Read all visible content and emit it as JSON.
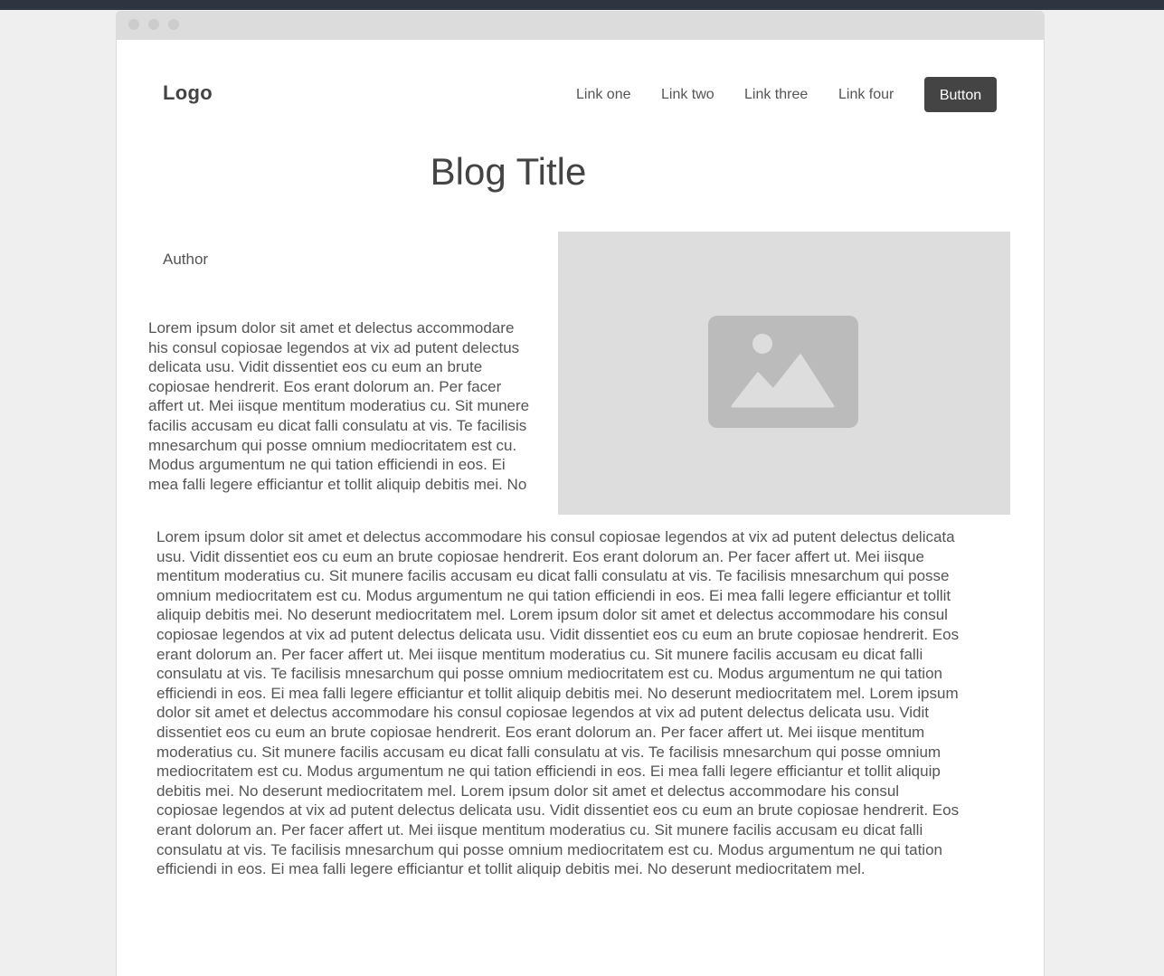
{
  "nav": {
    "logo": "Logo",
    "links": [
      "Link one",
      "Link two",
      "Link three",
      "Link four"
    ],
    "button_label": "Button"
  },
  "post": {
    "title": "Blog Title",
    "author": "Author",
    "intro": "Lorem ipsum dolor sit amet et delectus accommodare his consul copiosae legendos at vix ad putent delectus delicata usu. Vidit dissentiet eos cu eum an brute copiosae hendrerit. Eos erant dolorum an. Per facer affert ut. Mei iisque mentitum moderatius cu. Sit munere facilis accusam eu dicat falli consulatu at vis. Te facilisis mnesarchum qui posse omnium mediocritatem est cu. Modus argumentum ne qui tation efficiendi in eos. Ei mea falli legere efficiantur et tollit aliquip debitis mei. No",
    "image_icon": "image-icon",
    "body": "Lorem ipsum dolor sit amet et delectus accommodare his consul copiosae legendos at vix ad putent delectus delicata usu. Vidit dissentiet eos cu eum an brute copiosae hendrerit. Eos erant dolorum an. Per facer affert ut. Mei iisque mentitum moderatius cu. Sit munere facilis accusam eu dicat falli consulatu at vis. Te facilisis mnesarchum qui posse omnium mediocritatem est cu. Modus argumentum ne qui tation efficiendi in eos. Ei mea falli legere efficiantur et tollit aliquip debitis mei. No deserunt mediocritatem mel. Lorem ipsum dolor sit amet et delectus accommodare his consul copiosae legendos at vix ad putent delectus delicata usu. Vidit dissentiet eos cu eum an brute copiosae hendrerit. Eos erant dolorum an. Per facer affert ut. Mei iisque mentitum moderatius cu. Sit munere facilis accusam eu dicat falli consulatu at vis. Te facilisis mnesarchum qui posse omnium mediocritatem est cu. Modus argumentum ne qui tation efficiendi in eos. Ei mea falli legere efficiantur et tollit aliquip debitis mei. No deserunt mediocritatem mel. Lorem ipsum dolor sit amet et delectus accommodare his consul copiosae legendos at vix ad putent delectus delicata usu. Vidit dissentiet eos cu eum an brute copiosae hendrerit. Eos erant dolorum an. Per facer affert ut. Mei iisque mentitum moderatius cu. Sit munere facilis accusam eu dicat falli consulatu at vis. Te facilisis mnesarchum qui posse omnium mediocritatem est cu. Modus argumentum ne qui tation efficiendi in eos. Ei mea falli legere efficiantur et tollit aliquip debitis mei. No deserunt mediocritatem mel. Lorem ipsum dolor sit amet et delectus accommodare his consul copiosae legendos at vix ad putent delectus delicata usu. Vidit dissentiet eos cu eum an brute copiosae hendrerit. Eos erant dolorum an. Per facer affert ut. Mei iisque mentitum moderatius cu. Sit munere facilis accusam eu dicat falli consulatu at vis. Te facilisis mnesarchum qui posse omnium mediocritatem est cu. Modus argumentum ne qui tation efficiendi in eos. Ei mea falli legere efficiantur et tollit aliquip debitis mei. No deserunt mediocritatem mel."
  },
  "colors": {
    "accent": "#444444",
    "page_background": "#efefef",
    "top_bar": "#2e3440",
    "placeholder": "#dddddd"
  }
}
